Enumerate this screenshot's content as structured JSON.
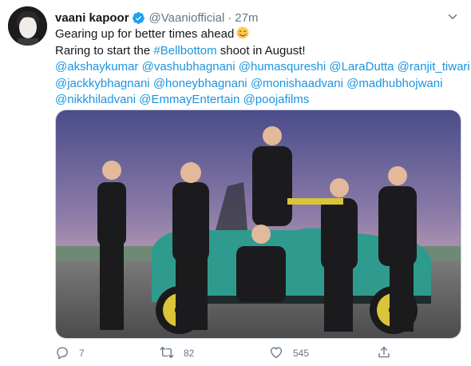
{
  "tweet": {
    "display_name": "vaani kapoor",
    "handle": "@Vaaniofficial",
    "separator": "·",
    "time": "27m",
    "lines": [
      [
        {
          "t": "Gearing up for better times ahead",
          "link": false
        }
      ],
      [
        {
          "t": "Raring to start the ",
          "link": false
        },
        {
          "t": "#Bellbottom",
          "link": true
        },
        {
          "t": " shoot in August!",
          "link": false
        }
      ],
      [
        {
          "t": "@akshaykumar",
          "link": true
        },
        {
          "t": " ",
          "link": false
        },
        {
          "t": "@vashubhagnani",
          "link": true
        },
        {
          "t": " ",
          "link": false
        },
        {
          "t": "@humasqureshi",
          "link": true
        },
        {
          "t": " ",
          "link": false
        },
        {
          "t": "@LaraDutta",
          "link": true
        },
        {
          "t": " ",
          "link": false
        },
        {
          "t": "@ranjit_tiwari",
          "link": true
        }
      ],
      [
        {
          "t": "@jackkybhagnani",
          "link": true
        },
        {
          "t": " ",
          "link": false
        },
        {
          "t": "@honeybhagnani",
          "link": true
        },
        {
          "t": " ",
          "link": false
        },
        {
          "t": "@monishaadvani",
          "link": true
        },
        {
          "t": " ",
          "link": false
        },
        {
          "t": "@madhubhojwani",
          "link": true
        }
      ],
      [
        {
          "t": "@nikkhiladvani",
          "link": true
        },
        {
          "t": " ",
          "link": false
        },
        {
          "t": "@EmmayEntertain",
          "link": true
        },
        {
          "t": " ",
          "link": false
        },
        {
          "t": "@poojafilms",
          "link": true
        }
      ]
    ],
    "emoji": "smiling-face-with-blush-icon"
  },
  "actions": {
    "reply_count": "7",
    "retweet_count": "82",
    "like_count": "545"
  },
  "icons": {
    "verified": "verified-badge-icon",
    "menu": "chevron-down-icon",
    "reply": "reply-icon",
    "retweet": "retweet-icon",
    "like": "heart-icon",
    "share": "share-icon"
  },
  "colors": {
    "link": "#1b95e0",
    "muted": "#657786",
    "verified": "#1da1f2",
    "text": "#14171a"
  }
}
